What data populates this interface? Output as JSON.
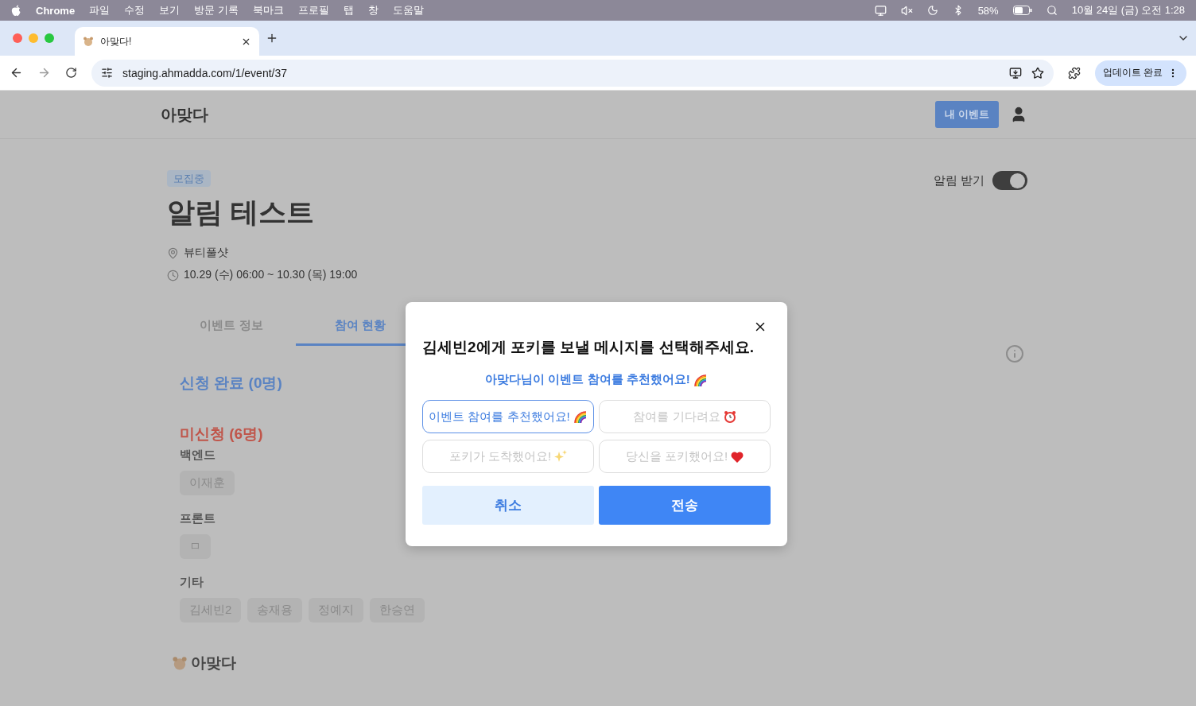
{
  "menubar": {
    "app": "Chrome",
    "menus": [
      "파일",
      "수정",
      "보기",
      "방문 기록",
      "북마크",
      "프로필",
      "탭",
      "창",
      "도움말"
    ],
    "battery": "58%",
    "clock": "10월 24일 (금) 오전 1:28"
  },
  "browser": {
    "tab": {
      "title": "아맞다!"
    },
    "url": "staging.ahmadda.com/1/event/37",
    "update_button": "업데이트 완료"
  },
  "header": {
    "logo": "아맞다",
    "my_events_button": "내 이벤트"
  },
  "event": {
    "status_badge": "모집중",
    "title": "알림 테스트",
    "location": "뷰티풀샷",
    "datetime": "10.29 (수) 06:00 ~ 10.30 (목) 19:00",
    "notify": {
      "label": "알림 받기",
      "on": true
    }
  },
  "tabs": [
    {
      "label": "이벤트 정보",
      "selected": false
    },
    {
      "label": "참여 현황",
      "selected": true
    }
  ],
  "applied": {
    "title": "신청 완료 (0명)"
  },
  "not_applied": {
    "title": "미신청 (6명)",
    "groups": [
      {
        "name": "백엔드",
        "members": [
          "이재훈"
        ]
      },
      {
        "name": "프론트",
        "members": [
          "ㅁ"
        ]
      },
      {
        "name": "기타",
        "members": [
          "김세빈2",
          "송재용",
          "정예지",
          "한승연"
        ]
      }
    ]
  },
  "footer": {
    "logo": "아맞다"
  },
  "modal": {
    "title": "김세빈2에게 포키를 보낼 메시지를 선택해주세요.",
    "preview": "아맞다님이 이벤트 참여를 추천했어요!",
    "options": [
      {
        "label": "이벤트 참여를 추천했어요!",
        "selected": true
      },
      {
        "label": "참여를 기다려요",
        "selected": false
      },
      {
        "label": "포키가 도착했어요!",
        "selected": false
      },
      {
        "label": "당신을 포키했어요!",
        "selected": false
      }
    ],
    "cancel_button": "취소",
    "send_button": "전송"
  }
}
